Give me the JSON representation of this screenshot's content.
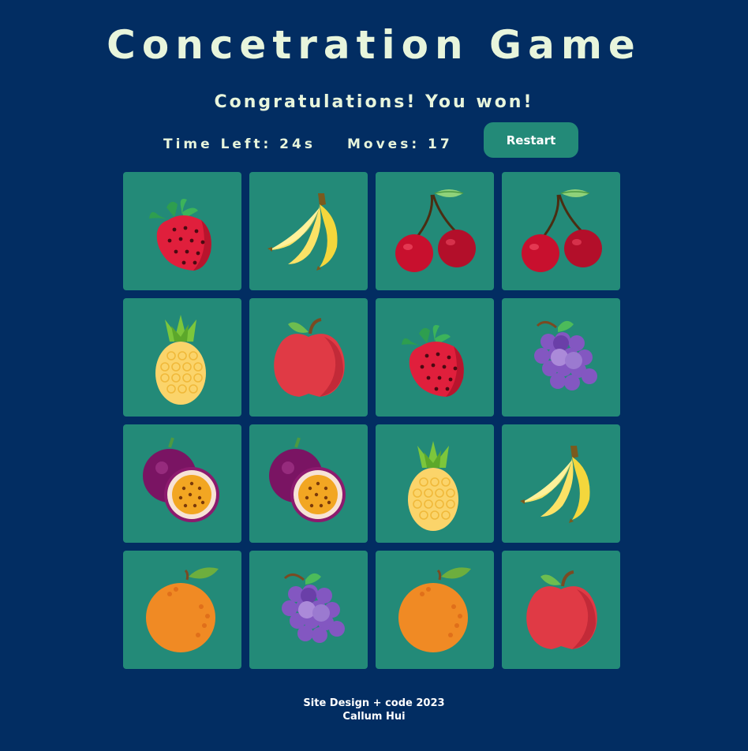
{
  "header": {
    "title": "Concetration Game",
    "status_message": "Congratulations! You won!"
  },
  "stats": {
    "time_left": "Time Left: 24s",
    "moves": "Moves: 17",
    "restart_label": "Restart"
  },
  "board": {
    "cards": [
      {
        "fruit": "strawberry",
        "icon": "strawberry-icon"
      },
      {
        "fruit": "banana",
        "icon": "banana-icon"
      },
      {
        "fruit": "cherry",
        "icon": "cherry-icon"
      },
      {
        "fruit": "cherry",
        "icon": "cherry-icon"
      },
      {
        "fruit": "pineapple",
        "icon": "pineapple-icon"
      },
      {
        "fruit": "apple",
        "icon": "apple-icon"
      },
      {
        "fruit": "strawberry",
        "icon": "strawberry-icon"
      },
      {
        "fruit": "grapes",
        "icon": "grapes-icon"
      },
      {
        "fruit": "passionfruit",
        "icon": "passionfruit-icon"
      },
      {
        "fruit": "passionfruit",
        "icon": "passionfruit-icon"
      },
      {
        "fruit": "pineapple",
        "icon": "pineapple-icon"
      },
      {
        "fruit": "banana",
        "icon": "banana-icon"
      },
      {
        "fruit": "orange",
        "icon": "orange-icon"
      },
      {
        "fruit": "grapes",
        "icon": "grapes-icon"
      },
      {
        "fruit": "orange",
        "icon": "orange-icon"
      },
      {
        "fruit": "apple",
        "icon": "apple-icon"
      }
    ]
  },
  "footer": {
    "line1": "Site Design + code 2023",
    "line2": "Callum Hui"
  },
  "colors": {
    "background": "#022d62",
    "card": "#238a78",
    "button": "#238a78",
    "text": "#e8f5dc"
  }
}
